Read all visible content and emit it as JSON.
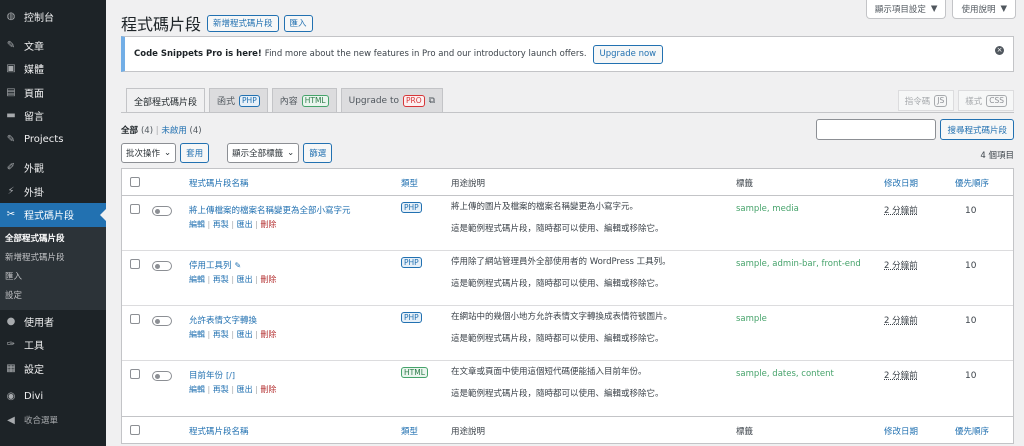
{
  "sidebar": {
    "items": [
      {
        "icon": "dashboard-icon",
        "glyph": "◍",
        "label": "控制台"
      },
      {
        "icon": "pin-icon",
        "glyph": "✎",
        "label": "文章"
      },
      {
        "icon": "media-icon",
        "glyph": "▣",
        "label": "媒體"
      },
      {
        "icon": "page-icon",
        "glyph": "▤",
        "label": "頁面"
      },
      {
        "icon": "comment-icon",
        "glyph": "▬",
        "label": "留言"
      },
      {
        "icon": "projects-icon",
        "glyph": "✎",
        "label": "Projects"
      },
      {
        "icon": "appearance-icon",
        "glyph": "✐",
        "label": "外觀"
      },
      {
        "icon": "plugin-icon",
        "glyph": "⚡",
        "label": "外掛"
      },
      {
        "icon": "scissors-icon",
        "glyph": "✂",
        "label": "程式碼片段"
      }
    ],
    "submenu": [
      "全部程式碼片段",
      "新增程式碼片段",
      "匯入",
      "設定"
    ],
    "items_after": [
      {
        "icon": "users-icon",
        "glyph": "●",
        "label": "使用者"
      },
      {
        "icon": "tools-icon",
        "glyph": "✑",
        "label": "工具"
      },
      {
        "icon": "settings-icon",
        "glyph": "▦",
        "label": "設定"
      },
      {
        "icon": "divi-icon",
        "glyph": "◉",
        "label": "Divi"
      },
      {
        "icon": "collapse-icon",
        "glyph": "◀",
        "label": "收合選單"
      }
    ]
  },
  "header": {
    "screen_options": "顯示項目設定",
    "help": "使用說明",
    "title": "程式碼片段",
    "add_new": "新增程式碼片段",
    "import": "匯入"
  },
  "notice": {
    "bold": "Code Snippets Pro is here!",
    "text": "Find more about the new features in Pro and our introductory launch offers.",
    "button": "Upgrade now"
  },
  "tabs": [
    {
      "label": "全部程式碼片段",
      "badge": ""
    },
    {
      "label": "函式",
      "badge": "PHP"
    },
    {
      "label": "內容",
      "badge": "HTML"
    },
    {
      "label": "Upgrade to",
      "badge": "PRO"
    }
  ],
  "right_tabs": [
    {
      "label": "指令碼",
      "badge": "JS"
    },
    {
      "label": "樣式",
      "badge": "CSS"
    }
  ],
  "filters": {
    "all": "全部",
    "all_count": "(4)",
    "divider": "|",
    "inactive": "未啟用",
    "inactive_count": "(4)"
  },
  "search": {
    "value": "",
    "button": "搜尋程式碼片段"
  },
  "tablenav": {
    "bulk": "批次操作",
    "apply": "套用",
    "tag_filter": "顯示全部標籤",
    "filter": "篩選",
    "count": "4 個項目"
  },
  "columns": {
    "name": "程式碼片段名稱",
    "type": "類型",
    "desc": "用途說明",
    "tags": "標籤",
    "modified": "修改日期",
    "priority": "優先順序"
  },
  "row_actions": {
    "edit": "編輯",
    "clone": "再製",
    "export": "匯出",
    "delete": "刪除",
    "sep": "|"
  },
  "snippets": [
    {
      "name": "將上傳檔案的檔案名稱變更為全部小寫字元",
      "extra": "",
      "type": "PHP",
      "desc1": "將上傳的圖片及檔案的檔案名稱變更為小寫字元。",
      "desc2": "這是範例程式碼片段，隨時都可以使用、編輯或移除它。",
      "tags": "sample, media",
      "modified": "2 分鐘前",
      "priority": "10"
    },
    {
      "name": "停用工具列",
      "extra": "✎",
      "type": "PHP",
      "desc1": "停用除了網站管理員外全部使用者的 WordPress 工具列。",
      "desc2": "這是範例程式碼片段，隨時都可以使用、編輯或移除它。",
      "tags": "sample, admin-bar, front-end",
      "modified": "2 分鐘前",
      "priority": "10"
    },
    {
      "name": "允許表情文字轉換",
      "extra": "",
      "type": "PHP",
      "desc1": "在網站中的幾個小地方允許表情文字轉換成表情符號圖片。",
      "desc2": "這是範例程式碼片段，隨時都可以使用、編輯或移除它。",
      "tags": "sample",
      "modified": "2 分鐘前",
      "priority": "10"
    },
    {
      "name": "目前年份",
      "extra": "[/]",
      "type": "HTML",
      "desc1": "在文章或頁面中使用這個短代碼便能插入目前年份。",
      "desc2": "這是範例程式碼片段，隨時都可以使用、編輯或移除它。",
      "tags": "sample, dates, content",
      "modified": "2 分鐘前",
      "priority": "10"
    }
  ]
}
